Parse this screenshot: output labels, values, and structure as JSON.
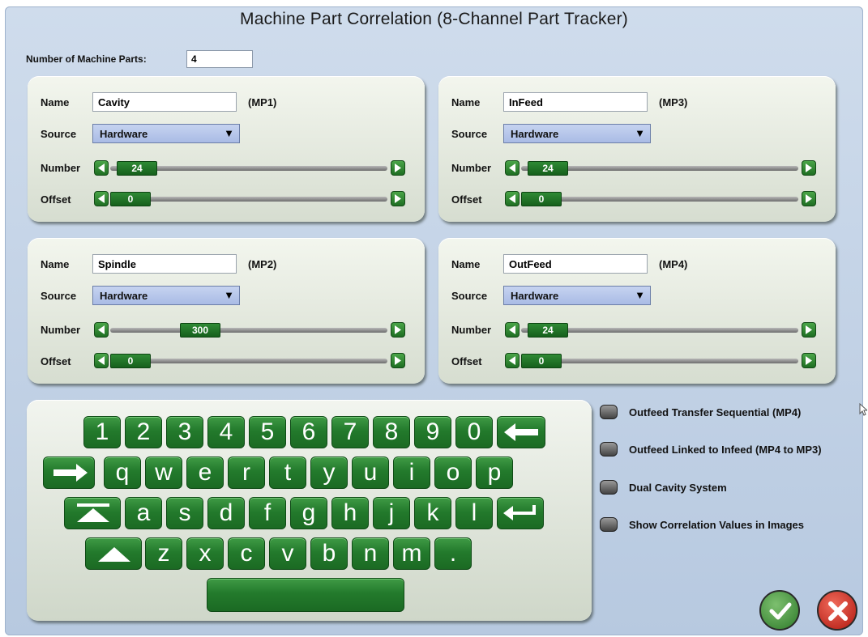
{
  "title": "Machine Part Correlation (8-Channel Part Tracker)",
  "count": {
    "label": "Number of Machine Parts:",
    "value": "4"
  },
  "labels": {
    "name": "Name",
    "source": "Source",
    "number": "Number",
    "offset": "Offset"
  },
  "parts": [
    {
      "name": "Cavity",
      "tag": "(MP1)",
      "source": "Hardware",
      "number": "24",
      "offset": "0"
    },
    {
      "name": "InFeed",
      "tag": "(MP3)",
      "source": "Hardware",
      "number": "24",
      "offset": "0"
    },
    {
      "name": "Spindle",
      "tag": "(MP2)",
      "source": "Hardware",
      "number": "300",
      "offset": "0"
    },
    {
      "name": "OutFeed",
      "tag": "(MP4)",
      "source": "Hardware",
      "number": "24",
      "offset": "0"
    }
  ],
  "keyboard": {
    "row1": [
      "1",
      "2",
      "3",
      "4",
      "5",
      "6",
      "7",
      "8",
      "9",
      "0"
    ],
    "row2": [
      "q",
      "w",
      "e",
      "r",
      "t",
      "y",
      "u",
      "i",
      "o",
      "p"
    ],
    "row3": [
      "a",
      "s",
      "d",
      "f",
      "g",
      "h",
      "j",
      "k",
      "l"
    ],
    "row4": [
      "z",
      "x",
      "c",
      "v",
      "b",
      "n",
      "m",
      "."
    ]
  },
  "options": [
    "Outfeed Transfer Sequential (MP4)",
    "Outfeed Linked to Infeed (MP4 to MP3)",
    "Dual Cavity System",
    "Show Correlation Values in Images"
  ],
  "colors": {
    "accent_green": "#237a2c",
    "ok_green": "#2e7a2a",
    "cancel_red": "#b01810",
    "select_blue": "#a9bbe5"
  }
}
